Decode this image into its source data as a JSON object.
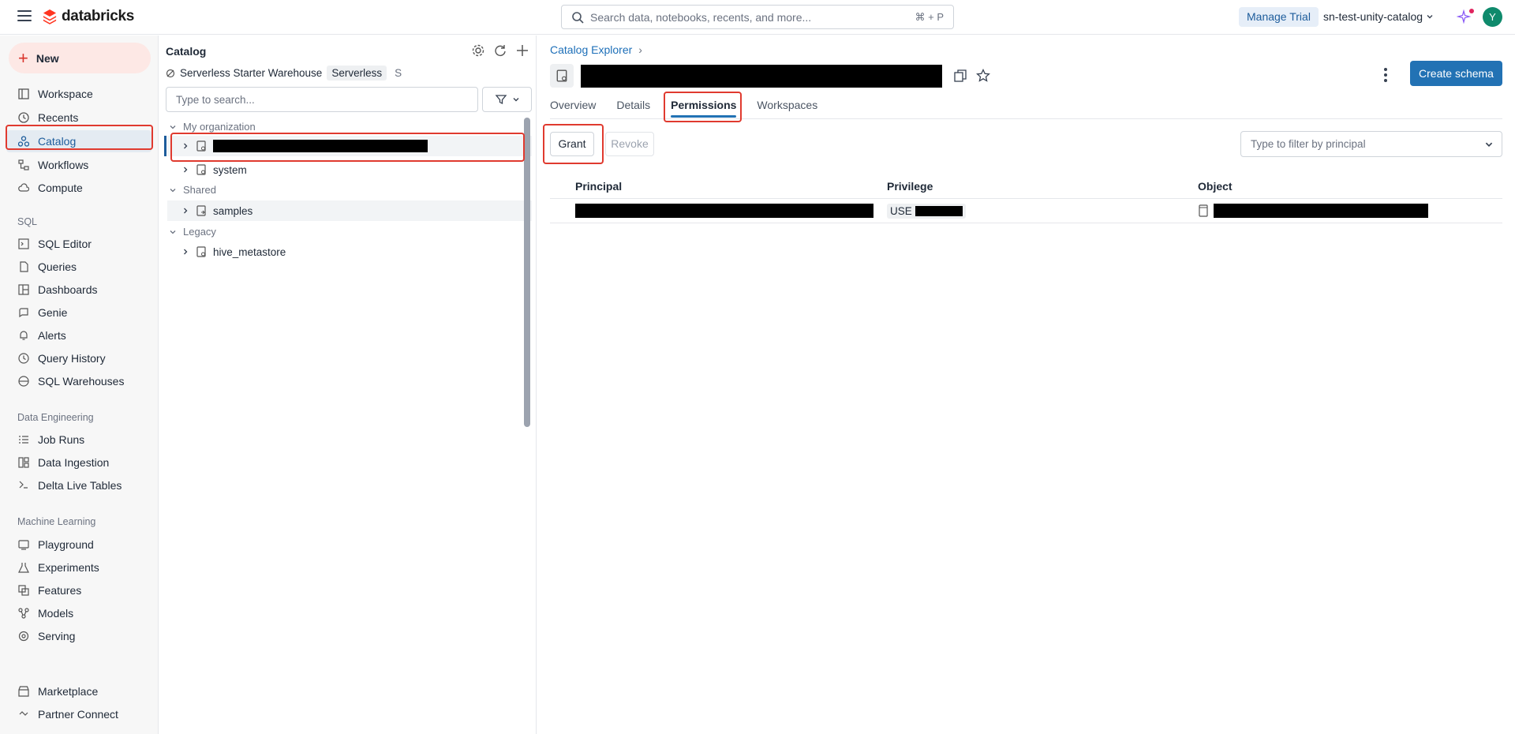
{
  "app": {
    "logo_text": "databricks"
  },
  "topbar": {
    "search_placeholder": "Search data, notebooks, recents, and more...",
    "search_shortcut": "⌘ + P",
    "manage_trial": "Manage Trial",
    "workspace": "sn-test-unity-catalog",
    "avatar_initial": "Y"
  },
  "leftnav": {
    "new_label": "New",
    "items": [
      {
        "label": "Workspace",
        "icon": "workspace-icon"
      },
      {
        "label": "Recents",
        "icon": "clock-icon"
      },
      {
        "label": "Catalog",
        "icon": "catalog-icon",
        "active": true
      },
      {
        "label": "Workflows",
        "icon": "workflows-icon"
      },
      {
        "label": "Compute",
        "icon": "cloud-icon"
      }
    ],
    "sql_section": "SQL",
    "sql_items": [
      {
        "label": "SQL Editor",
        "icon": "sql-editor-icon"
      },
      {
        "label": "Queries",
        "icon": "queries-icon"
      },
      {
        "label": "Dashboards",
        "icon": "dashboards-icon"
      },
      {
        "label": "Genie",
        "icon": "genie-icon"
      },
      {
        "label": "Alerts",
        "icon": "bell-icon"
      },
      {
        "label": "Query History",
        "icon": "history-icon"
      },
      {
        "label": "SQL Warehouses",
        "icon": "warehouse-icon"
      }
    ],
    "de_section": "Data Engineering",
    "de_items": [
      {
        "label": "Job Runs",
        "icon": "job-runs-icon"
      },
      {
        "label": "Data Ingestion",
        "icon": "ingestion-icon"
      },
      {
        "label": "Delta Live Tables",
        "icon": "dlt-icon"
      }
    ],
    "ml_section": "Machine Learning",
    "ml_items": [
      {
        "label": "Playground",
        "icon": "playground-icon"
      },
      {
        "label": "Experiments",
        "icon": "experiments-icon"
      },
      {
        "label": "Features",
        "icon": "features-icon"
      },
      {
        "label": "Models",
        "icon": "models-icon"
      },
      {
        "label": "Serving",
        "icon": "serving-icon"
      }
    ],
    "bottom_items": [
      {
        "label": "Marketplace",
        "icon": "marketplace-icon"
      },
      {
        "label": "Partner Connect",
        "icon": "partner-connect-icon"
      }
    ]
  },
  "catalog_panel": {
    "title": "Catalog",
    "warehouse": "Serverless Starter Warehouse",
    "warehouse_badge": "Serverless",
    "warehouse_size": "S",
    "search_placeholder": "Type to search...",
    "groups": {
      "my_org": "My organization",
      "shared": "Shared",
      "legacy": "Legacy"
    },
    "items": {
      "system": "system",
      "samples": "samples",
      "hive": "hive_metastore"
    }
  },
  "main": {
    "breadcrumb": "Catalog Explorer",
    "create_schema": "Create schema",
    "tabs": [
      "Overview",
      "Details",
      "Permissions",
      "Workspaces"
    ],
    "active_tab": "Permissions",
    "grant": "Grant",
    "revoke": "Revoke",
    "filter_placeholder": "Type to filter by principal",
    "columns": [
      "Principal",
      "Privilege",
      "Object"
    ],
    "row_privilege_prefix": "USE"
  },
  "colors": {
    "accent": "#2272b4",
    "highlight": "#e03a2f"
  }
}
